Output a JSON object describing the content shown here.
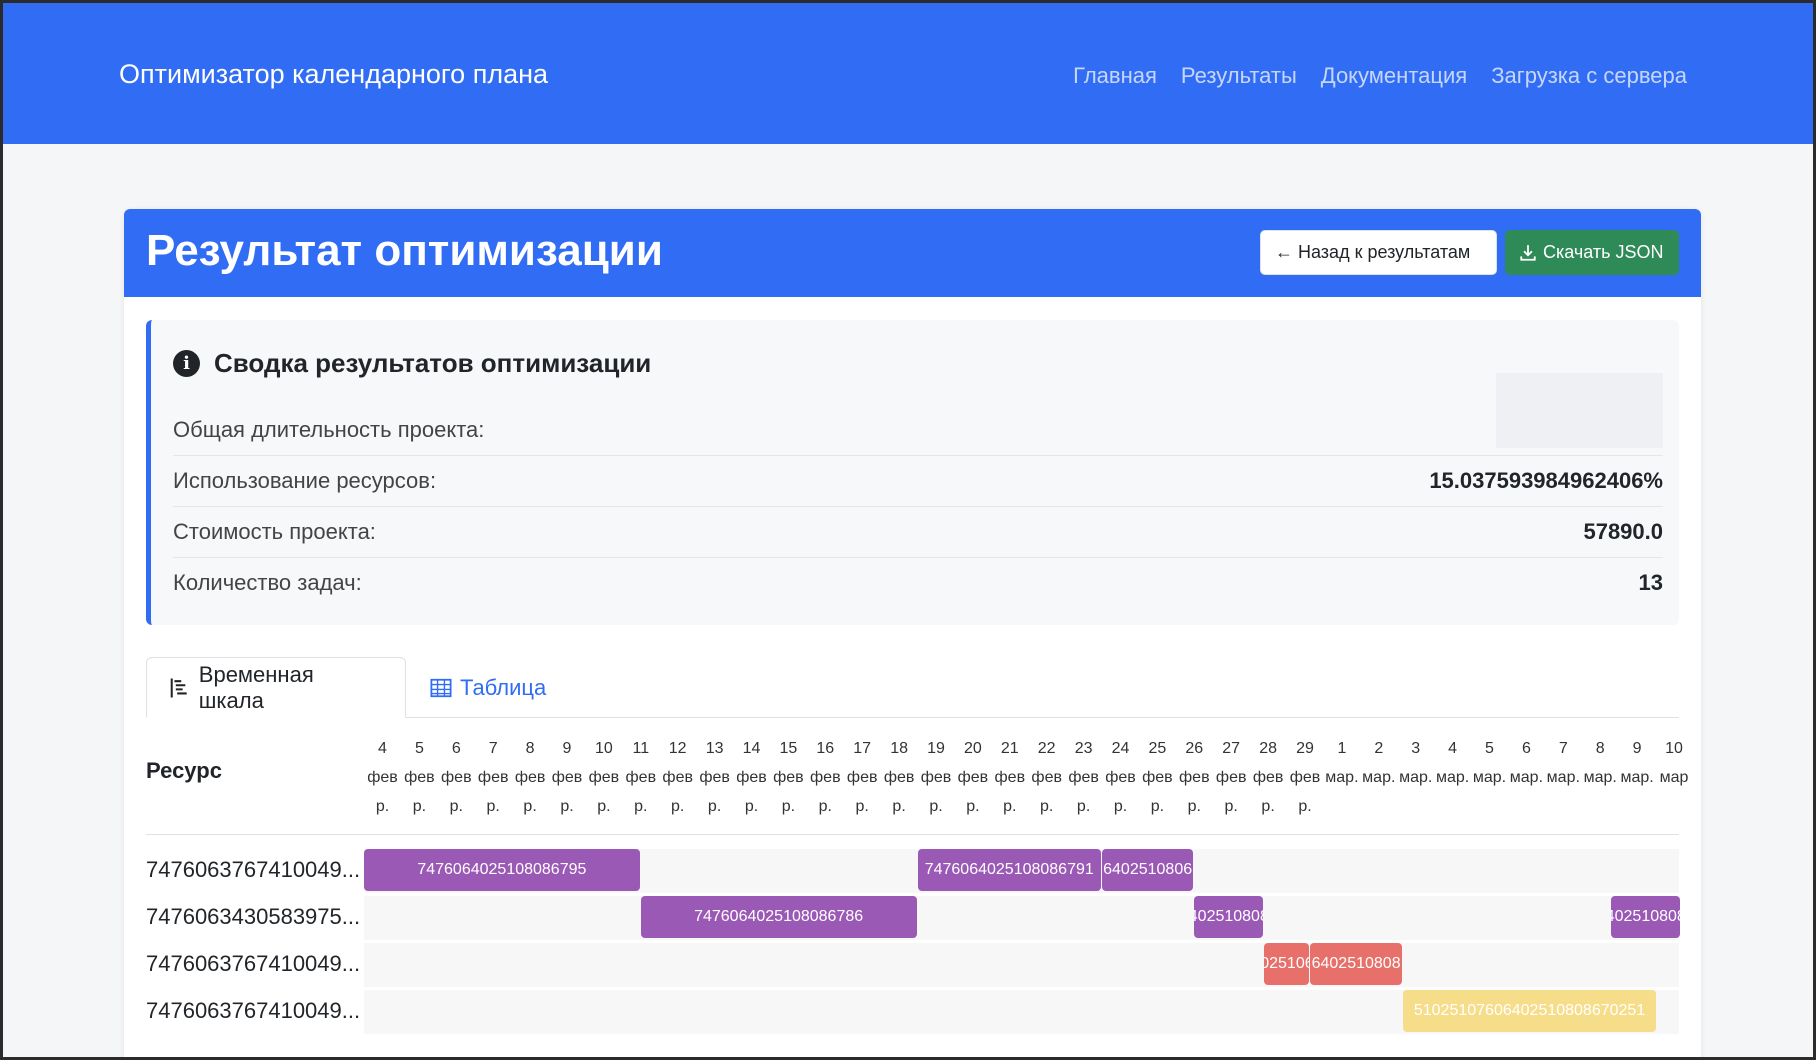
{
  "navbar": {
    "brand": "Оптимизатор календарного плана",
    "links": [
      "Главная",
      "Результаты",
      "Документация",
      "Загрузка с сервера"
    ]
  },
  "header": {
    "title": "Результат оптимизации",
    "back_label": "← Назад к результатам",
    "download_label": "Скачать JSON"
  },
  "summary": {
    "title": "Сводка результатов оптимизации",
    "rows": [
      {
        "label": "Общая длительность проекта:",
        "value": ""
      },
      {
        "label": "Использование ресурсов:",
        "value": "15.037593984962406%"
      },
      {
        "label": "Стоимость проекта:",
        "value": "57890.0"
      },
      {
        "label": "Количество задач:",
        "value": "13"
      }
    ]
  },
  "tabs": {
    "timeline": "Временная шкала",
    "table": "Таблица"
  },
  "timeline": {
    "resource_header": "Ресурс",
    "days": [
      {
        "d": "4",
        "m": "фев",
        "y": "р."
      },
      {
        "d": "5",
        "m": "фев",
        "y": "р."
      },
      {
        "d": "6",
        "m": "фев",
        "y": "р."
      },
      {
        "d": "7",
        "m": "фев",
        "y": "р."
      },
      {
        "d": "8",
        "m": "фев",
        "y": "р."
      },
      {
        "d": "9",
        "m": "фев",
        "y": "р."
      },
      {
        "d": "10",
        "m": "фев",
        "y": "р."
      },
      {
        "d": "11",
        "m": "фев",
        "y": "р."
      },
      {
        "d": "12",
        "m": "фев",
        "y": "р."
      },
      {
        "d": "13",
        "m": "фев",
        "y": "р."
      },
      {
        "d": "14",
        "m": "фев",
        "y": "р."
      },
      {
        "d": "15",
        "m": "фев",
        "y": "р."
      },
      {
        "d": "16",
        "m": "фев",
        "y": "р."
      },
      {
        "d": "17",
        "m": "фев",
        "y": "р."
      },
      {
        "d": "18",
        "m": "фев",
        "y": "р."
      },
      {
        "d": "19",
        "m": "фев",
        "y": "р."
      },
      {
        "d": "20",
        "m": "фев",
        "y": "р."
      },
      {
        "d": "21",
        "m": "фев",
        "y": "р."
      },
      {
        "d": "22",
        "m": "фев",
        "y": "р."
      },
      {
        "d": "23",
        "m": "фев",
        "y": "р."
      },
      {
        "d": "24",
        "m": "фев",
        "y": "р."
      },
      {
        "d": "25",
        "m": "фев",
        "y": "р."
      },
      {
        "d": "26",
        "m": "фев",
        "y": "р."
      },
      {
        "d": "27",
        "m": "фев",
        "y": "р."
      },
      {
        "d": "28",
        "m": "фев",
        "y": "р."
      },
      {
        "d": "29",
        "m": "фев",
        "y": "р."
      },
      {
        "d": "1",
        "m": "мар.",
        "y": ""
      },
      {
        "d": "2",
        "m": "мар.",
        "y": ""
      },
      {
        "d": "3",
        "m": "мар.",
        "y": ""
      },
      {
        "d": "4",
        "m": "мар.",
        "y": ""
      },
      {
        "d": "5",
        "m": "мар.",
        "y": ""
      },
      {
        "d": "6",
        "m": "мар.",
        "y": ""
      },
      {
        "d": "7",
        "m": "мар.",
        "y": ""
      },
      {
        "d": "8",
        "m": "мар.",
        "y": ""
      },
      {
        "d": "9",
        "m": "мар.",
        "y": ""
      },
      {
        "d": "10",
        "m": "мар",
        "y": ""
      }
    ],
    "rows": [
      {
        "name": "7476063767410049...",
        "tasks": [
          {
            "label": "7476064025108086795",
            "start": 0,
            "days": 7.5,
            "color": "purple"
          },
          {
            "label": "7476064025108086791",
            "start": 15,
            "days": 5,
            "color": "purple"
          },
          {
            "label": "6402510806",
            "start": 20,
            "days": 2.5,
            "color": "purple"
          }
        ]
      },
      {
        "name": "7476063430583975...",
        "tasks": [
          {
            "label": "7476064025108086786",
            "start": 7.5,
            "days": 7.5,
            "color": "purple"
          },
          {
            "label": "402510808",
            "start": 22.5,
            "days": 1.9,
            "color": "purple"
          },
          {
            "label": "402510808",
            "start": 33.8,
            "days": 1.9,
            "color": "purple"
          }
        ]
      },
      {
        "name": "7476063767410049...",
        "tasks": [
          {
            "label": "025106",
            "start": 24.4,
            "days": 1.25,
            "color": "red"
          },
          {
            "label": "6402510808",
            "start": 25.65,
            "days": 2.5,
            "color": "red"
          }
        ]
      },
      {
        "name": "7476063767410049...",
        "tasks": [
          {
            "label": "51025107606402510808670251",
            "start": 28.15,
            "days": 6.9,
            "color": "yellow"
          }
        ]
      }
    ]
  }
}
